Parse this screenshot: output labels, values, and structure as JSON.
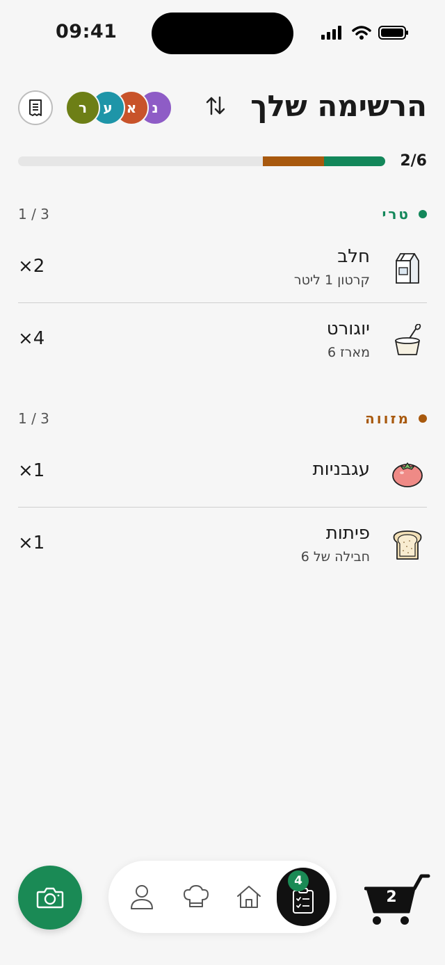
{
  "status_bar": {
    "time": "09:41"
  },
  "header": {
    "title": "הרשימה שלך",
    "avatars": [
      {
        "initial": "נ",
        "color": "#8e5cc6"
      },
      {
        "initial": "א",
        "color": "#c8532a"
      },
      {
        "initial": "ע",
        "color": "#1e95a8"
      },
      {
        "initial": "ר",
        "color": "#6d7f16"
      }
    ]
  },
  "progress": {
    "label": "2/6",
    "done_fraction": 0.1667,
    "partial_fraction": 0.1667,
    "done_color": "#13875a",
    "partial_color": "#a8590e"
  },
  "sections": [
    {
      "title": "טרי",
      "color": "#13875a",
      "count": "1 / 3",
      "items": [
        {
          "name": "חלב",
          "sub": "קרטון 1 ליטר",
          "qty": "×2",
          "icon": "milk-carton-icon"
        },
        {
          "name": "יוגורט",
          "sub": "מארז 6",
          "qty": "×4",
          "icon": "yogurt-cup-icon"
        }
      ]
    },
    {
      "title": "מזווה",
      "color": "#a8590e",
      "count": "1 / 3",
      "items": [
        {
          "name": "עגבניות",
          "sub": "",
          "qty": "×1",
          "icon": "tomato-icon"
        },
        {
          "name": "פיתות",
          "sub": "חבילה של 6",
          "qty": "×1",
          "icon": "bread-slice-icon"
        }
      ]
    }
  ],
  "bottom_nav": {
    "list_badge": "4",
    "cart_count": "2",
    "accent": "#1a8a55"
  }
}
